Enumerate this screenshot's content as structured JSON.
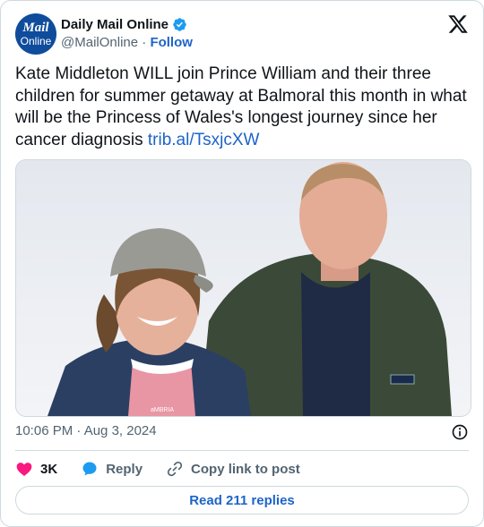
{
  "account": {
    "avatar_line1": "Mail",
    "avatar_line2": "Online",
    "display_name": "Daily Mail Online",
    "handle": "@MailOnline",
    "separator": "·",
    "follow_label": "Follow"
  },
  "tweet": {
    "text": "Kate Middleton WILL join Prince William and their three children for summer getaway at Balmoral this month in what will be the Princess of Wales's longest journey since her cancer diagnosis ",
    "link": "trib.al/TsxjcXW",
    "timestamp": "10:06 PM · Aug 3, 2024"
  },
  "actions": {
    "likes": "3K",
    "reply_label": "Reply",
    "copy_label": "Copy link to post"
  },
  "read_replies_label": "Read 211 replies",
  "photo_details": {
    "vest_text": "aMBRIA"
  },
  "colors": {
    "link": "#1d64c8",
    "heart": "#f91880",
    "reply_bubble": "#1d9bf0",
    "avatar_bg": "#0f4c9c",
    "border": "#cfd9de"
  },
  "icons": {
    "platform": "x-logo-icon",
    "verified": "verified-badge-icon",
    "info": "info-icon",
    "like": "heart-icon",
    "reply": "reply-bubble-icon",
    "copy": "link-icon"
  }
}
